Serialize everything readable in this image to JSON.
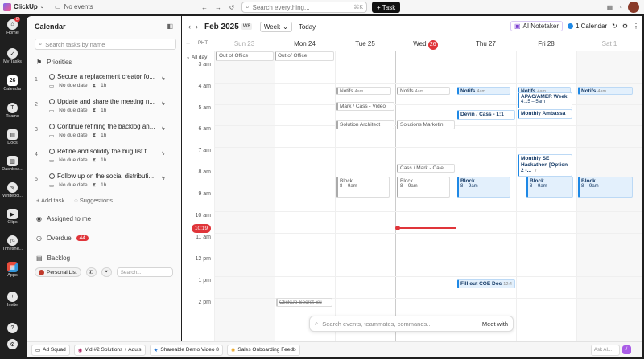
{
  "topbar": {
    "workspace": "ClickUp",
    "no_events": "No events",
    "search_placeholder": "Search everything...",
    "search_kbd": "⌘K",
    "new_task": "+ Task"
  },
  "rail": [
    {
      "label": "Home",
      "icon": "home-icon",
      "badge": "8"
    },
    {
      "label": "My Tasks",
      "icon": "check-circle-icon"
    },
    {
      "label": "Calendar",
      "icon": "calendar-icon",
      "glyph": "26"
    },
    {
      "label": "Teams",
      "icon": "teams-icon"
    },
    {
      "label": "Docs",
      "icon": "docs-icon"
    },
    {
      "label": "Dashboa...",
      "icon": "dashboard-icon"
    },
    {
      "label": "Whitebo...",
      "icon": "whiteboard-icon"
    },
    {
      "label": "Clips",
      "icon": "clips-icon"
    },
    {
      "label": "Timeshe...",
      "icon": "timesheet-icon"
    },
    {
      "label": "Apps",
      "icon": "apps-icon"
    },
    {
      "label": "Invite",
      "icon": "invite-icon"
    }
  ],
  "panel": {
    "title": "Calendar",
    "search_placeholder": "Search tasks by name",
    "priorities": "Priorities",
    "tasks": [
      {
        "num": "1",
        "title": "Secure a replacement creator fo...",
        "due": "No due date",
        "est": "1h"
      },
      {
        "num": "2",
        "title": "Update and share the meeting n...",
        "due": "No due date",
        "est": "1h"
      },
      {
        "num": "3",
        "title": "Continue refining the backlog an...",
        "due": "No due date",
        "est": "1h"
      },
      {
        "num": "4",
        "title": "Refine and solidify the bug list t...",
        "due": "No due date",
        "est": "1h"
      },
      {
        "num": "5",
        "title": "Follow up on the social distributi...",
        "due": "No due date",
        "est": "1h"
      }
    ],
    "add_task": "+ Add task",
    "suggestions": "Suggestions",
    "assigned": "Assigned to me",
    "overdue": "Overdue",
    "overdue_count": "44",
    "backlog": "Backlog",
    "personal_list": "Personal List",
    "filter_search": "Search..."
  },
  "calendar": {
    "month": "Feb 2025",
    "week": "W8",
    "view": "Week",
    "today": "Today",
    "notetaker": "AI Notetaker",
    "calendars": "1 Calendar",
    "tz": "PHT",
    "all_day": "All day",
    "days": [
      {
        "label": "Sun 23",
        "dim": true
      },
      {
        "label": "Mon 24"
      },
      {
        "label": "Tue 25"
      },
      {
        "label": "Wed",
        "today": "26"
      },
      {
        "label": "Thu 27"
      },
      {
        "label": "Fri 28"
      },
      {
        "label": "Sat 1",
        "dim": true
      }
    ],
    "hours": [
      "3 am",
      "4 am",
      "5 am",
      "6 am",
      "7 am",
      "8 am",
      "9 am",
      "10 am",
      "11 am",
      "12 pm",
      "1 pm",
      "2 pm"
    ],
    "now": "10:19",
    "allday_events": [
      "Out of Office",
      "Out of Office"
    ],
    "events": {
      "notifs": "Notifs",
      "notifs_time": "4am",
      "mark_cass_video": "Mark / Cass - Video",
      "solution_architect": "Solution Architect",
      "solutions_marketing": "Solutions Marketin",
      "cass_mark_cal": "Cass / Mark - Cale",
      "block": "Block",
      "block_time": "8 – 9am",
      "devin_cass": "Devin / Cass - 1:1",
      "apac": "APAC/AMER Week",
      "apac_time": "4:15 – 5am",
      "monthly_amb": "Monthly Ambassa",
      "monthly_se": "Monthly SE Hackathon [Option 2 -...",
      "monthly_se_tag": "7",
      "coe": "Fill out COE Doc",
      "coe_time": "12:4",
      "secret": "ClickUp Secret Su"
    },
    "cmd_placeholder": "Search events, teammates, commands...",
    "meet_with": "Meet with"
  },
  "bottom": {
    "tabs": [
      "Ad Squad",
      "Vid #2 Solutions + Aquis",
      "Shareable Demo Video 8",
      "Sales Onboarding Feedb"
    ],
    "ask_ai": "Ask AI..."
  },
  "colors": {
    "accent": "#e0353a",
    "event_blue": "#1e88e5",
    "brand": "#7b68ee"
  }
}
